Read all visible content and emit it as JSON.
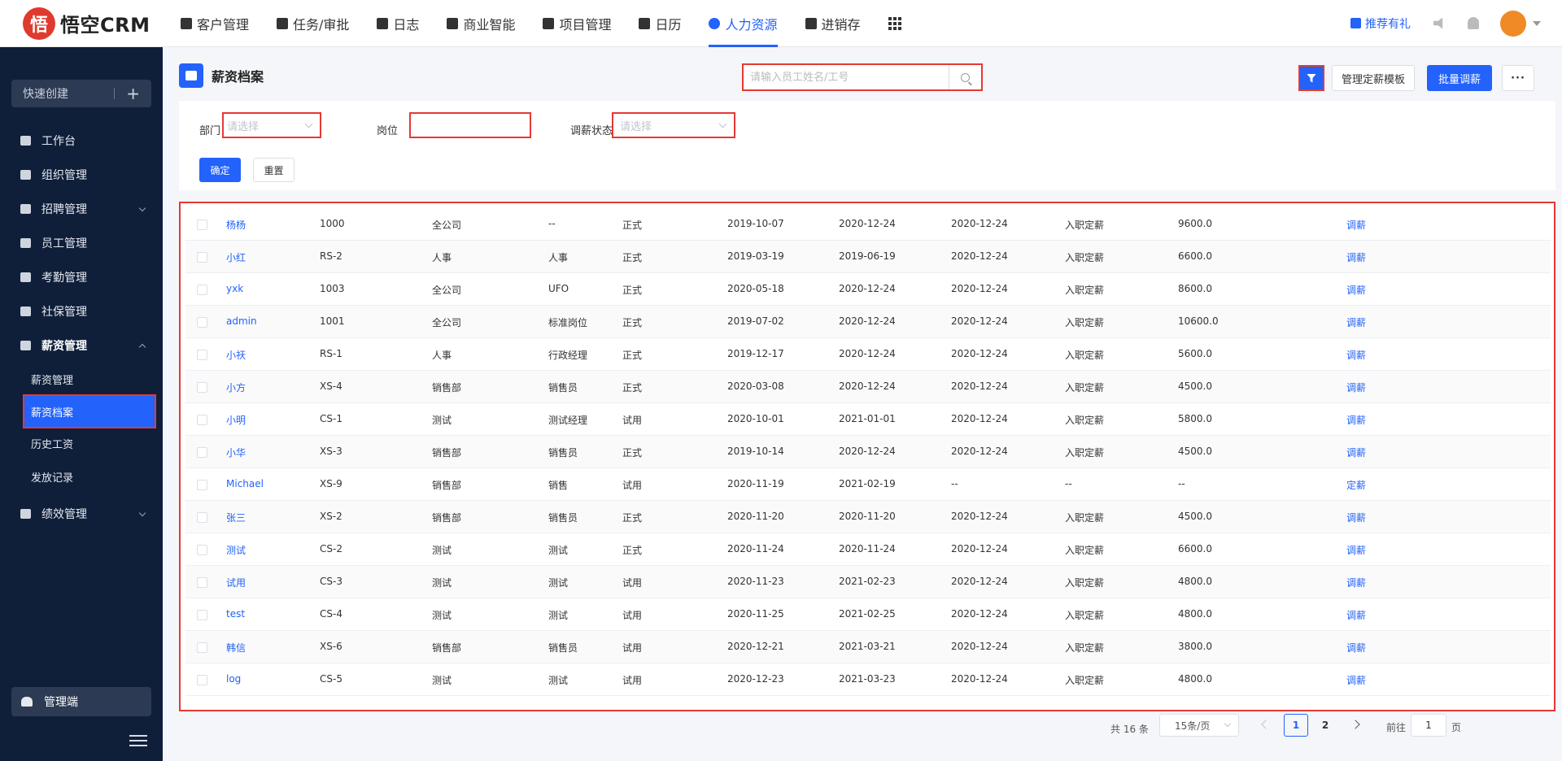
{
  "app": {
    "logo_glyph": "悟",
    "logo_text": "悟空CRM"
  },
  "topnav": {
    "items": [
      "客户管理",
      "任务/审批",
      "日志",
      "商业智能",
      "项目管理",
      "日历",
      "人力资源",
      "进销存"
    ],
    "active": "人力资源",
    "recommend": "推荐有礼"
  },
  "sidebar": {
    "quick_create": "快速创建",
    "plus": "+",
    "items": [
      "工作台",
      "组织管理",
      "招聘管理",
      "员工管理",
      "考勤管理",
      "社保管理",
      "薪资管理"
    ],
    "sub_items": [
      "薪资管理",
      "薪资档案",
      "历史工资",
      "发放记录"
    ],
    "after_items": [
      "绩效管理"
    ],
    "admin": "管理端"
  },
  "page": {
    "title": "薪资档案",
    "search_placeholder": "请输入员工姓名/工号",
    "btn_template": "管理定薪模板",
    "btn_batch": "批量调薪",
    "btn_more": "···"
  },
  "filters": {
    "dept_label": "部门",
    "dept_placeholder": "请选择",
    "post_label": "岗位",
    "status_label": "调薪状态",
    "status_placeholder": "请选择",
    "ok": "确定",
    "reset": "重置"
  },
  "table": {
    "rows": [
      [
        "杨杨",
        "1000",
        "全公司",
        "--",
        "正式",
        "2019-10-07",
        "2020-12-24",
        "2020-12-24",
        "入职定薪",
        "9600.0",
        "调薪"
      ],
      [
        "小红",
        "RS-2",
        "人事",
        "人事",
        "正式",
        "2019-03-19",
        "2019-06-19",
        "2020-12-24",
        "入职定薪",
        "6600.0",
        "调薪"
      ],
      [
        "yxk",
        "1003",
        "全公司",
        "UFO",
        "正式",
        "2020-05-18",
        "2020-12-24",
        "2020-12-24",
        "入职定薪",
        "8600.0",
        "调薪"
      ],
      [
        "admin",
        "1001",
        "全公司",
        "标准岗位",
        "正式",
        "2019-07-02",
        "2020-12-24",
        "2020-12-24",
        "入职定薪",
        "10600.0",
        "调薪"
      ],
      [
        "小祆",
        "RS-1",
        "人事",
        "行政经理",
        "正式",
        "2019-12-17",
        "2020-12-24",
        "2020-12-24",
        "入职定薪",
        "5600.0",
        "调薪"
      ],
      [
        "小方",
        "XS-4",
        "销售部",
        "销售员",
        "正式",
        "2020-03-08",
        "2020-12-24",
        "2020-12-24",
        "入职定薪",
        "4500.0",
        "调薪"
      ],
      [
        "小明",
        "CS-1",
        "测试",
        "测试经理",
        "试用",
        "2020-10-01",
        "2021-01-01",
        "2020-12-24",
        "入职定薪",
        "5800.0",
        "调薪"
      ],
      [
        "小华",
        "XS-3",
        "销售部",
        "销售员",
        "正式",
        "2019-10-14",
        "2020-12-24",
        "2020-12-24",
        "入职定薪",
        "4500.0",
        "调薪"
      ],
      [
        "Michael",
        "XS-9",
        "销售部",
        "销售",
        "试用",
        "2020-11-19",
        "2021-02-19",
        "--",
        "--",
        "--",
        "定薪"
      ],
      [
        "张三",
        "XS-2",
        "销售部",
        "销售员",
        "正式",
        "2020-11-20",
        "2020-11-20",
        "2020-12-24",
        "入职定薪",
        "4500.0",
        "调薪"
      ],
      [
        "测试",
        "CS-2",
        "测试",
        "测试",
        "正式",
        "2020-11-24",
        "2020-11-24",
        "2020-12-24",
        "入职定薪",
        "6600.0",
        "调薪"
      ],
      [
        "试用",
        "CS-3",
        "测试",
        "测试",
        "试用",
        "2020-11-23",
        "2021-02-23",
        "2020-12-24",
        "入职定薪",
        "4800.0",
        "调薪"
      ],
      [
        "test",
        "CS-4",
        "测试",
        "测试",
        "试用",
        "2020-11-25",
        "2021-02-25",
        "2020-12-24",
        "入职定薪",
        "4800.0",
        "调薪"
      ],
      [
        "韩信",
        "XS-6",
        "销售部",
        "销售员",
        "试用",
        "2020-12-21",
        "2021-03-21",
        "2020-12-24",
        "入职定薪",
        "3800.0",
        "调薪"
      ],
      [
        "log",
        "CS-5",
        "测试",
        "测试",
        "试用",
        "2020-12-23",
        "2021-03-23",
        "2020-12-24",
        "入职定薪",
        "4800.0",
        "调薪"
      ]
    ]
  },
  "pagination": {
    "total": "共 16 条",
    "page_size": "15条/页",
    "pages": [
      "1",
      "2"
    ],
    "current": "1",
    "goto_label": "前往",
    "goto_value": "1",
    "page_suffix": "页"
  },
  "colors": {
    "accent": "#2362fb",
    "highlight": "#e53935",
    "sidebar_bg": "#0f1f3a"
  }
}
